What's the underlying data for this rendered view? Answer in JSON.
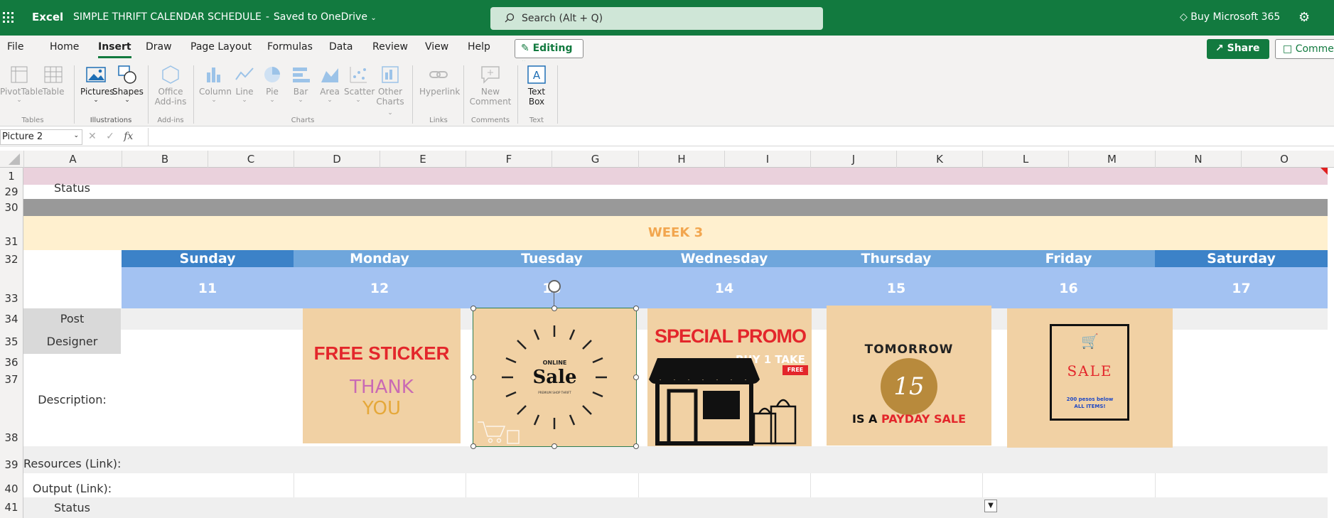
{
  "titlebar": {
    "app": "Excel",
    "doc_title": "SIMPLE THRIFT CALENDAR SCHEDULE",
    "separator": "-",
    "save_status": "Saved to OneDrive",
    "search_placeholder": "Search (Alt + Q)",
    "buy": "Buy Microsoft 365",
    "brand_color": "#127a3f"
  },
  "menu": {
    "items": [
      "File",
      "Home",
      "Insert",
      "Draw",
      "Page Layout",
      "Formulas",
      "Data",
      "Review",
      "View",
      "Help"
    ],
    "active": "Insert",
    "editing": "Editing",
    "share": "Share",
    "comments": "Comments"
  },
  "ribbon": {
    "pivottable": "PivotTable",
    "table": "Table",
    "group_tables": "Tables",
    "pictures": "Pictures",
    "shapes": "Shapes",
    "group_illustrations": "Illustrations",
    "office": "Office",
    "addins": "Add-ins",
    "group_addins": "Add-ins",
    "column": "Column",
    "line": "Line",
    "pie": "Pie",
    "bar": "Bar",
    "area": "Area",
    "scatter": "Scatter",
    "other": "Other",
    "charts": "Charts",
    "group_charts": "Charts",
    "hyperlink": "Hyperlink",
    "group_links": "Links",
    "new": "New",
    "comment": "Comment",
    "group_comments": "Comments",
    "text": "Text",
    "box": "Box",
    "group_text": "Text"
  },
  "formula_bar": {
    "name_box": "Picture 2",
    "fx": "fx"
  },
  "columns": [
    "A",
    "B",
    "C",
    "D",
    "E",
    "F",
    "G",
    "H",
    "I",
    "J",
    "K",
    "L",
    "M",
    "N",
    "O"
  ],
  "rows": [
    "1",
    "29",
    "30",
    "31",
    "32",
    "33",
    "34",
    "35",
    "36",
    "37",
    "38",
    "39",
    "40",
    "41"
  ],
  "sheet": {
    "status_top": "Status",
    "week": "WEEK 3",
    "days": [
      "Sunday",
      "Monday",
      "Tuesday",
      "Wednesday",
      "Thursday",
      "Friday",
      "Saturday"
    ],
    "dates": [
      "11",
      "12",
      "13",
      "14",
      "15",
      "16",
      "17"
    ],
    "row_labels": {
      "post": "Post",
      "designer": "Designer",
      "description": "Description:",
      "resources": "Resources (Link):",
      "output": "Output (Link):",
      "status": "Status"
    }
  },
  "cards": {
    "monday": {
      "line1": "FREE STICKER",
      "line2": "THANK",
      "line3": "YOU"
    },
    "tuesday": {
      "small": "ONLINE",
      "big": "Sale",
      "tiny": "PREMIUM SHOP THRIFT"
    },
    "wednesday": {
      "title": "SPECIAL PROMO",
      "sub": "BUY 1 TAKE 1",
      "badge": "FREE"
    },
    "thursday": {
      "arc": "TOMORROW",
      "num": "15",
      "pre": "IS A",
      "hi": "PAYDAY SALE"
    },
    "friday": {
      "title": "SALE",
      "note1": "200 pesos below",
      "note2": "ALL ITEMS!"
    }
  },
  "colors": {
    "week_band": "#fff0cf",
    "week_text": "#f2a64f",
    "day_dark": "#3c82c8",
    "day_light": "#6fa6dc",
    "date_band": "#a3c2f2",
    "pink_row": "#ead1dc",
    "gray_row": "#999999",
    "card": "#f1d1a4"
  }
}
